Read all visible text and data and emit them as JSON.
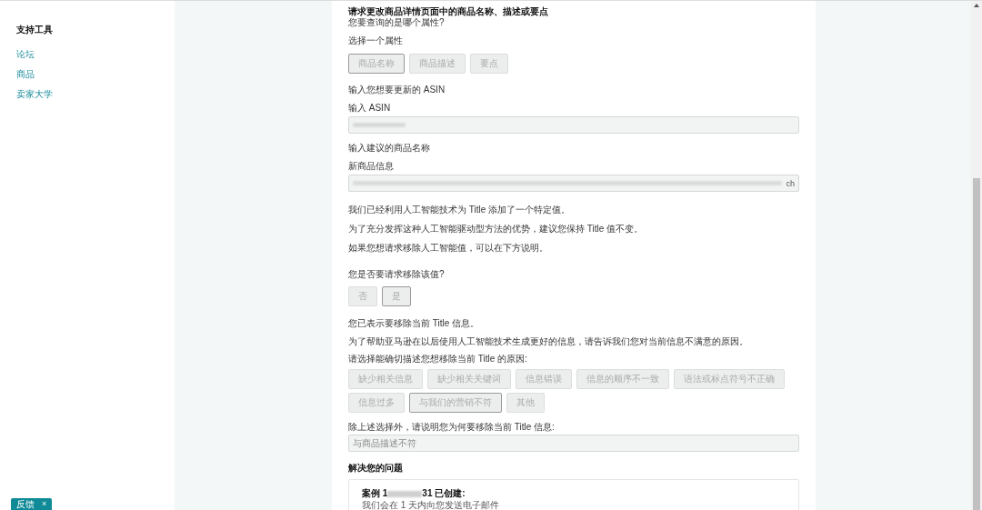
{
  "sidebar": {
    "title": "支持工具",
    "links": [
      "论坛",
      "商品",
      "卖家大学"
    ]
  },
  "feedback": {
    "label": "反馈",
    "close": "×"
  },
  "form": {
    "title": "请求更改商品详情页面中的商品名称、描述或要点",
    "subtitle": "您要查询的是哪个属性?",
    "attribute_label": "选择一个属性",
    "attributes": [
      {
        "label": "商品名称",
        "selected": true
      },
      {
        "label": "商品描述",
        "selected": false
      },
      {
        "label": "要点",
        "selected": false
      }
    ],
    "asin_prompt": "输入您想要更新的 ASIN",
    "asin_label": "输入 ASIN",
    "name_prompt": "输入建议的商品名称",
    "name_label": "新商品信息",
    "name_value_tail": "ch",
    "ai_notes": [
      "我们已经利用人工智能技术为 Title 添加了一个特定值。",
      "为了充分发挥这种人工智能驱动型方法的优势，建议您保持 Title 值不变。",
      "如果您想请求移除人工智能值，可以在下方说明。"
    ],
    "remove_question": "您是否要请求移除该值?",
    "remove_options": [
      {
        "label": "否",
        "selected": false
      },
      {
        "label": "是",
        "selected": true
      }
    ],
    "remove_notes": [
      "您已表示要移除当前 Title 信息。",
      "为了帮助亚马逊在以后使用人工智能技术生成更好的信息，请告诉我们您对当前信息不满意的原因。"
    ],
    "reason_label": "请选择能确切描述您想移除当前 Title 的原因:",
    "reasons": [
      {
        "label": "缺少相关信息",
        "selected": false
      },
      {
        "label": "缺少相关关键词",
        "selected": false
      },
      {
        "label": "信息错误",
        "selected": false
      },
      {
        "label": "信息的顺序不一致",
        "selected": false
      },
      {
        "label": "语法或标点符号不正确",
        "selected": false
      },
      {
        "label": "信息过多",
        "selected": false
      },
      {
        "label": "与我们的营销不符",
        "selected": true
      },
      {
        "label": "其他",
        "selected": false
      }
    ],
    "other_label": "除上述选择外，请说明您为何要移除当前 Title 信息:",
    "other_value": "与商品描述不符",
    "resolve_title": "解决您的问题",
    "case_prefix": "案例 1",
    "case_suffix": "31 已创建:",
    "case_note": "我们会在 1 天内向您发送电子邮件"
  }
}
